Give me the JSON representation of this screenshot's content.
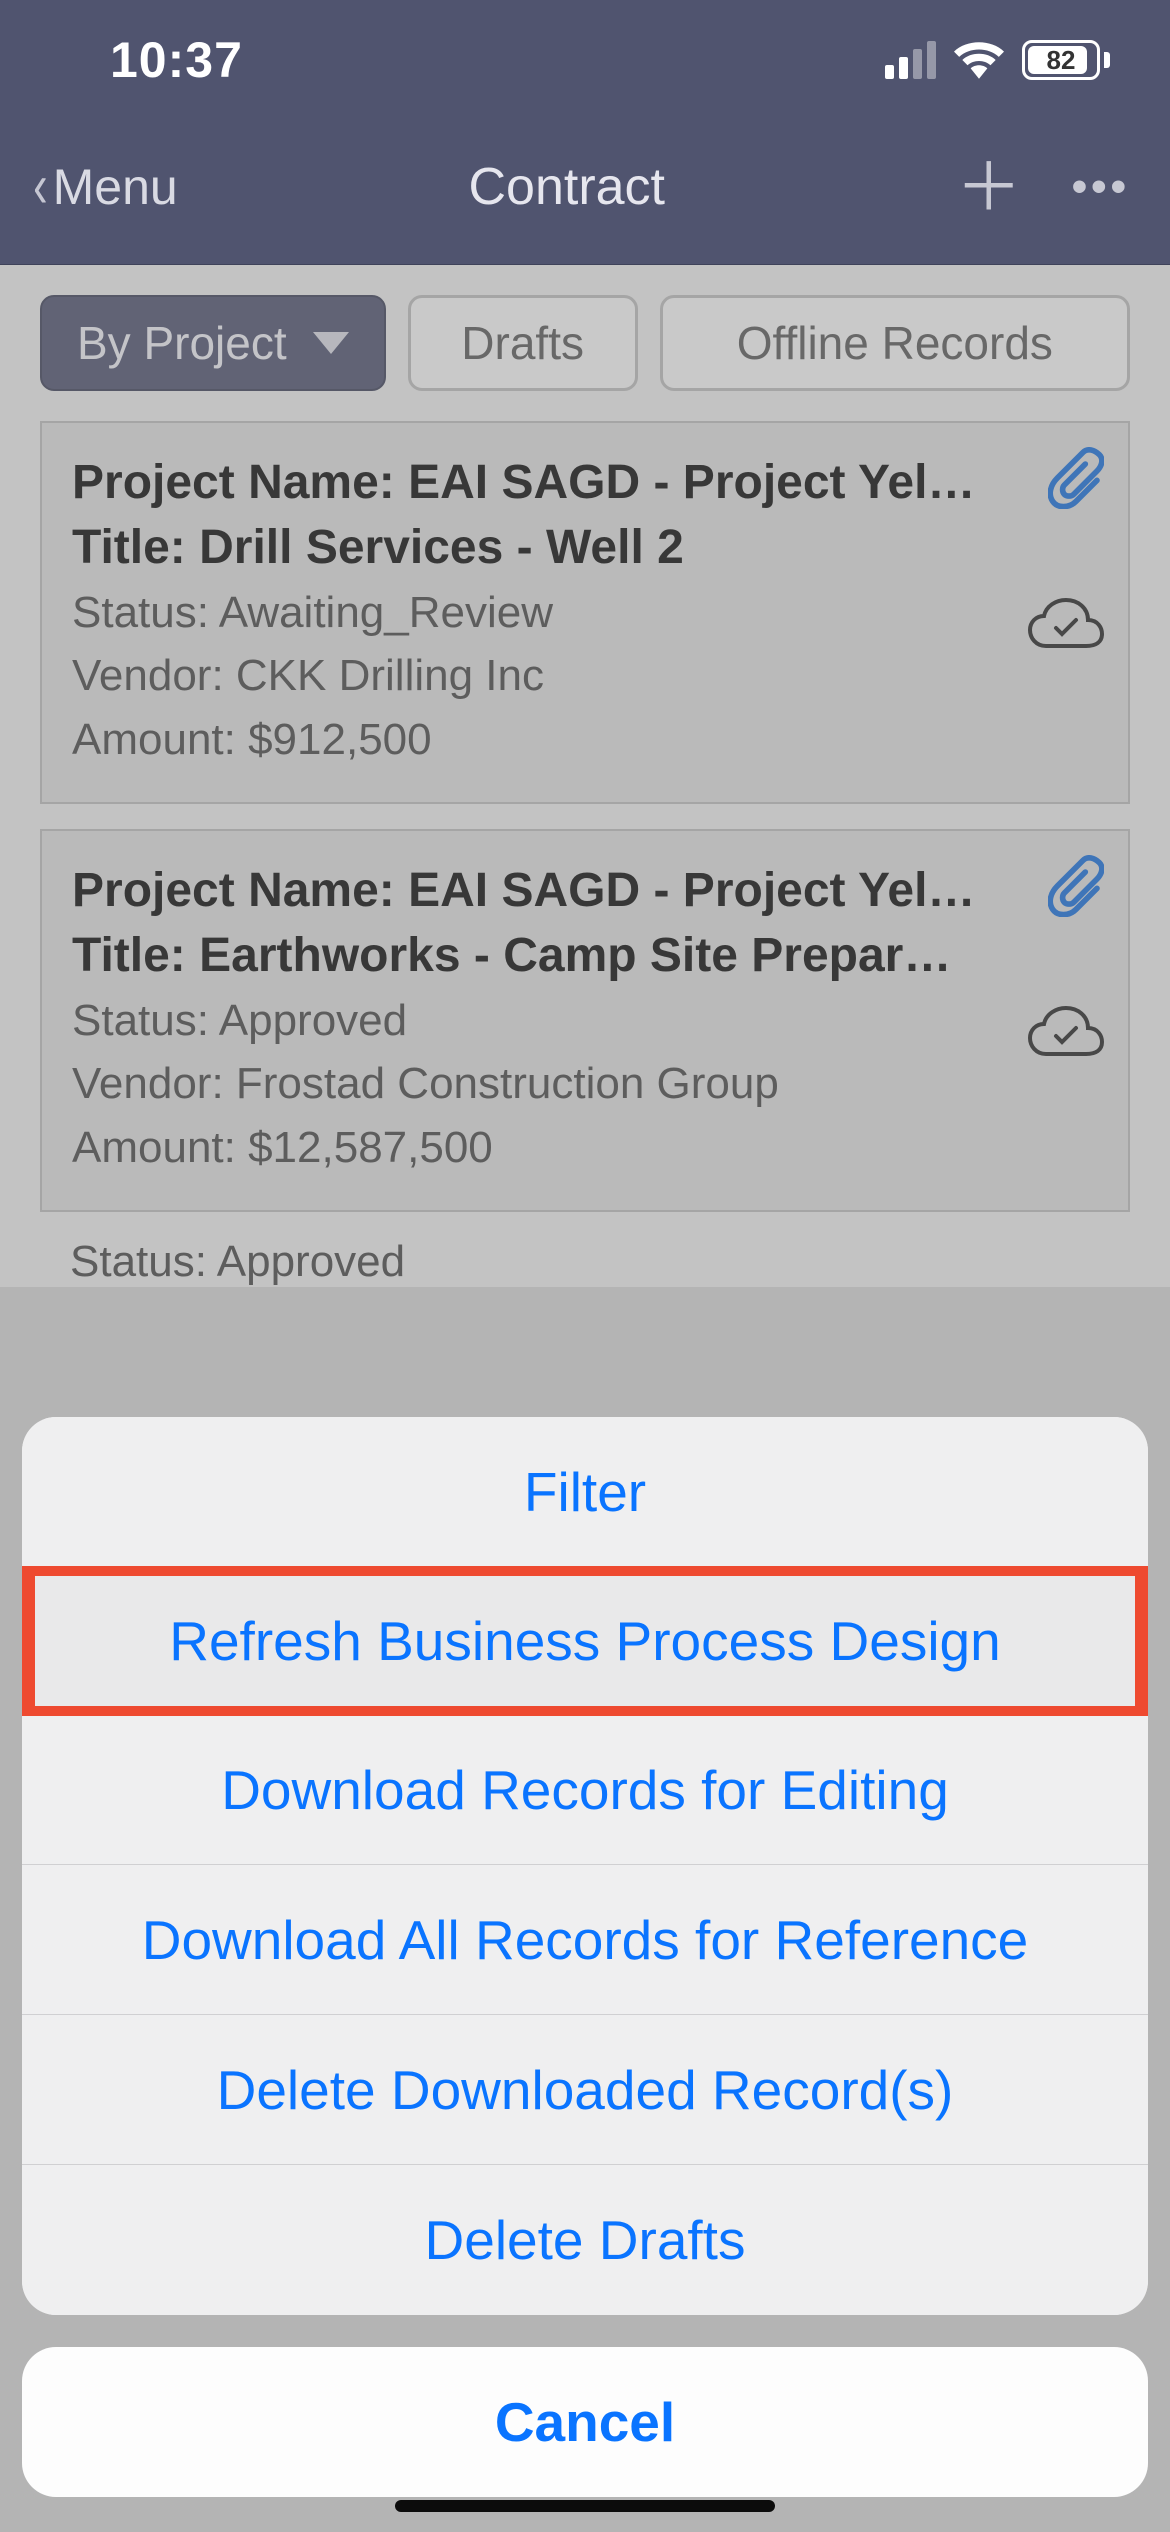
{
  "status_bar": {
    "time": "10:37",
    "battery": "82"
  },
  "nav": {
    "back_label": "Menu",
    "title": "Contract"
  },
  "filters": {
    "view_selector": "By Project",
    "drafts": "Drafts",
    "offline": "Offline Records"
  },
  "records": [
    {
      "project_label": "Project Name: EAI SAGD - Project Yel…",
      "title_label": "Title: Drill Services - Well 2",
      "status": "Status: Awaiting_Review",
      "vendor": "Vendor: CKK Drilling Inc",
      "amount": "Amount: $912,500"
    },
    {
      "project_label": "Project Name: EAI SAGD - Project Yel…",
      "title_label": "Title: Earthworks - Camp Site Prepar…",
      "status": "Status: Approved",
      "vendor": "Vendor: Frostad Construction Group",
      "amount": "Amount: $12,587,500"
    }
  ],
  "sheet": {
    "items": [
      "Filter",
      "Refresh Business Process Design",
      "Download Records for Editing",
      "Download All Records for Reference",
      "Delete Downloaded Record(s)",
      "Delete Drafts"
    ],
    "cancel": "Cancel"
  },
  "partial_text": "Status: Approved"
}
